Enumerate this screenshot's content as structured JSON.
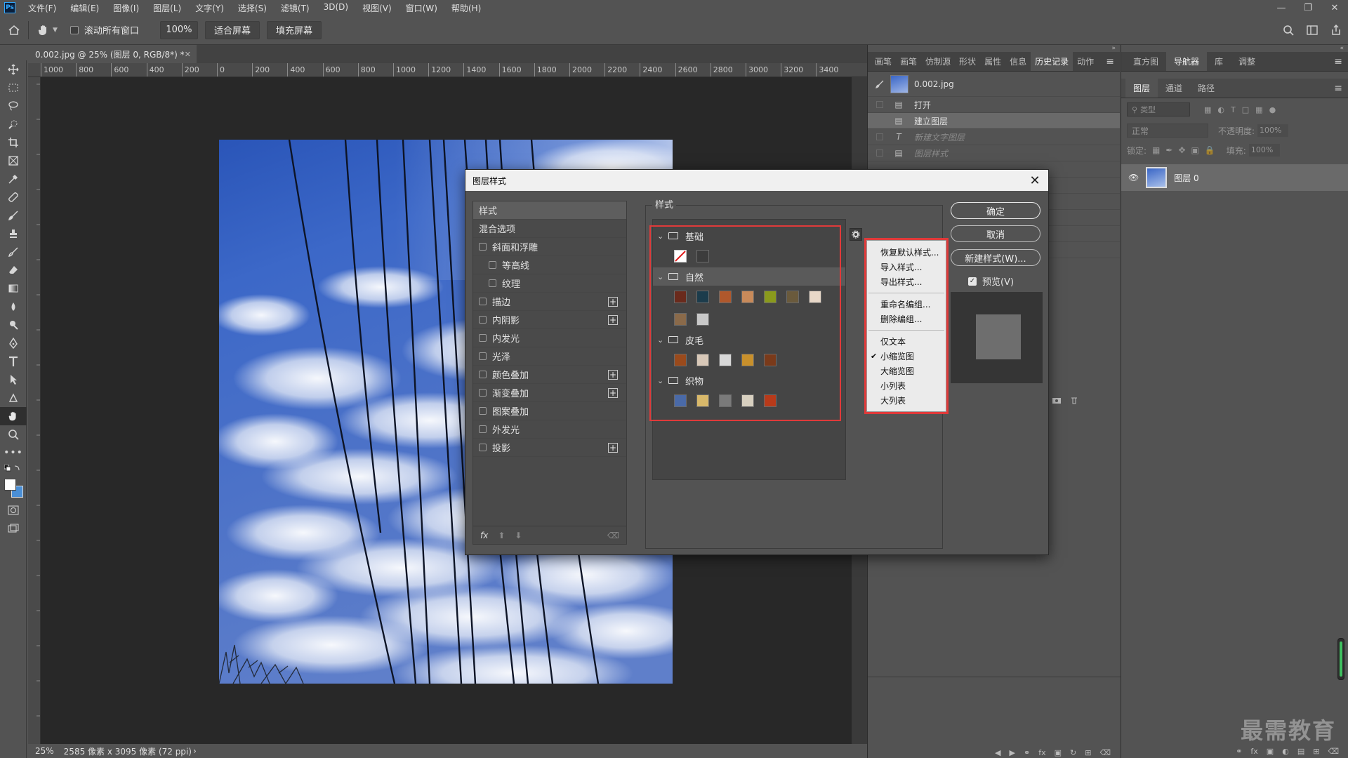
{
  "menubar": {
    "logo": "Ps",
    "items": [
      "文件(F)",
      "编辑(E)",
      "图像(I)",
      "图层(L)",
      "文字(Y)",
      "选择(S)",
      "滤镜(T)",
      "3D(D)",
      "视图(V)",
      "窗口(W)",
      "帮助(H)"
    ]
  },
  "options": {
    "scroll_all_label": "滚动所有窗口",
    "zoom_value": "100%",
    "fit_screen": "适合屏幕",
    "fill_screen": "填充屏幕"
  },
  "document": {
    "tab_title": "0.002.jpg @ 25% (图层 0, RGB/8*) *",
    "ruler_labels": [
      "1000",
      "800",
      "600",
      "400",
      "200",
      "0",
      "200",
      "400",
      "600",
      "800",
      "1000",
      "1200",
      "1400",
      "1600",
      "1800",
      "2000",
      "2200",
      "2400",
      "2600",
      "2800",
      "3000",
      "3200",
      "3400"
    ],
    "status_zoom": "25%",
    "status_info": "2585 像素 x 3095 像素 (72 ppi)"
  },
  "history_panel": {
    "tabs": [
      "画笔",
      "画笔",
      "仿制源",
      "形状",
      "属性",
      "信息",
      "历史记录",
      "动作"
    ],
    "active_tab": "历史记录",
    "snapshot": "0.002.jpg",
    "items": [
      {
        "label": "打开",
        "state": "normal"
      },
      {
        "label": "建立图层",
        "state": "selected"
      },
      {
        "label": "新建文字图层",
        "state": "dim"
      },
      {
        "label": "图层样式",
        "state": "dim"
      }
    ]
  },
  "right_panel": {
    "top_tabs": [
      "直方图",
      "导航器",
      "库",
      "调整"
    ],
    "active_top_tab": "导航器",
    "layer_tabs": [
      "图层",
      "通道",
      "路径"
    ],
    "active_layer_tab": "图层",
    "filter_placeholder": "类型",
    "blend_mode": "正常",
    "opacity_label": "不透明度:",
    "opacity_value": "100%",
    "lock_label": "锁定:",
    "fill_label": "填充:",
    "fill_value": "100%",
    "layer_name": "图层 0"
  },
  "dialog": {
    "title": "图层样式",
    "left_list": [
      {
        "label": "样式",
        "type": "header",
        "indent": 0,
        "checkbox": false,
        "plus": false
      },
      {
        "label": "混合选项",
        "type": "item",
        "indent": 0,
        "checkbox": false,
        "plus": false
      },
      {
        "label": "斜面和浮雕",
        "type": "item",
        "indent": 0,
        "checkbox": true,
        "plus": false
      },
      {
        "label": "等高线",
        "type": "item",
        "indent": 1,
        "checkbox": true,
        "plus": false
      },
      {
        "label": "纹理",
        "type": "item",
        "indent": 1,
        "checkbox": true,
        "plus": false
      },
      {
        "label": "描边",
        "type": "item",
        "indent": 0,
        "checkbox": true,
        "plus": true
      },
      {
        "label": "内阴影",
        "type": "item",
        "indent": 0,
        "checkbox": true,
        "plus": true
      },
      {
        "label": "内发光",
        "type": "item",
        "indent": 0,
        "checkbox": true,
        "plus": false
      },
      {
        "label": "光泽",
        "type": "item",
        "indent": 0,
        "checkbox": true,
        "plus": false
      },
      {
        "label": "颜色叠加",
        "type": "item",
        "indent": 0,
        "checkbox": true,
        "plus": true
      },
      {
        "label": "渐变叠加",
        "type": "item",
        "indent": 0,
        "checkbox": true,
        "plus": true
      },
      {
        "label": "图案叠加",
        "type": "item",
        "indent": 0,
        "checkbox": true,
        "plus": false
      },
      {
        "label": "外发光",
        "type": "item",
        "indent": 0,
        "checkbox": true,
        "plus": false
      },
      {
        "label": "投影",
        "type": "item",
        "indent": 0,
        "checkbox": true,
        "plus": true
      }
    ],
    "fx_label": "fx",
    "group_title": "样式",
    "categories": [
      {
        "name": "基础",
        "swatch_rows": [
          [
            "none",
            "#3c3c3c"
          ]
        ]
      },
      {
        "name": "自然",
        "swatch_rows": [
          [
            "#6a2a1c",
            "#1c3c4c",
            "#b0582c",
            "#c88a5a",
            "#8a9a1c",
            "#6a5a3c",
            "#e8d8c8"
          ],
          [
            "#8a6a4a",
            "#c8c8c8"
          ]
        ]
      },
      {
        "name": "皮毛",
        "swatch_rows": [
          [
            "#9a4a1c",
            "#d8c8b8",
            "#d8d8d8",
            "#c8902c",
            "#7a3a1a"
          ]
        ]
      },
      {
        "name": "织物",
        "swatch_rows": [
          [
            "#4a6aa8",
            "#d8b86a",
            "#7a7a7a",
            "#d8d0c0",
            "#b83a1a"
          ]
        ]
      }
    ],
    "context_menu": {
      "group1": [
        "恢复默认样式...",
        "导入样式...",
        "导出样式..."
      ],
      "group2": [
        "重命名编组...",
        "删除编组..."
      ],
      "group3": [
        "仅文本",
        "小缩览图",
        "大缩览图",
        "小列表",
        "大列表"
      ],
      "checked": "小缩览图"
    },
    "ok_button": "确定",
    "cancel_button": "取消",
    "new_style_button": "新建样式(W)...",
    "preview_label": "预览(V)"
  },
  "watermark": "最需教育",
  "colors": {
    "accent_red": "#e03a3a",
    "panel_bg": "#535353",
    "canvas_bg": "#282828"
  }
}
